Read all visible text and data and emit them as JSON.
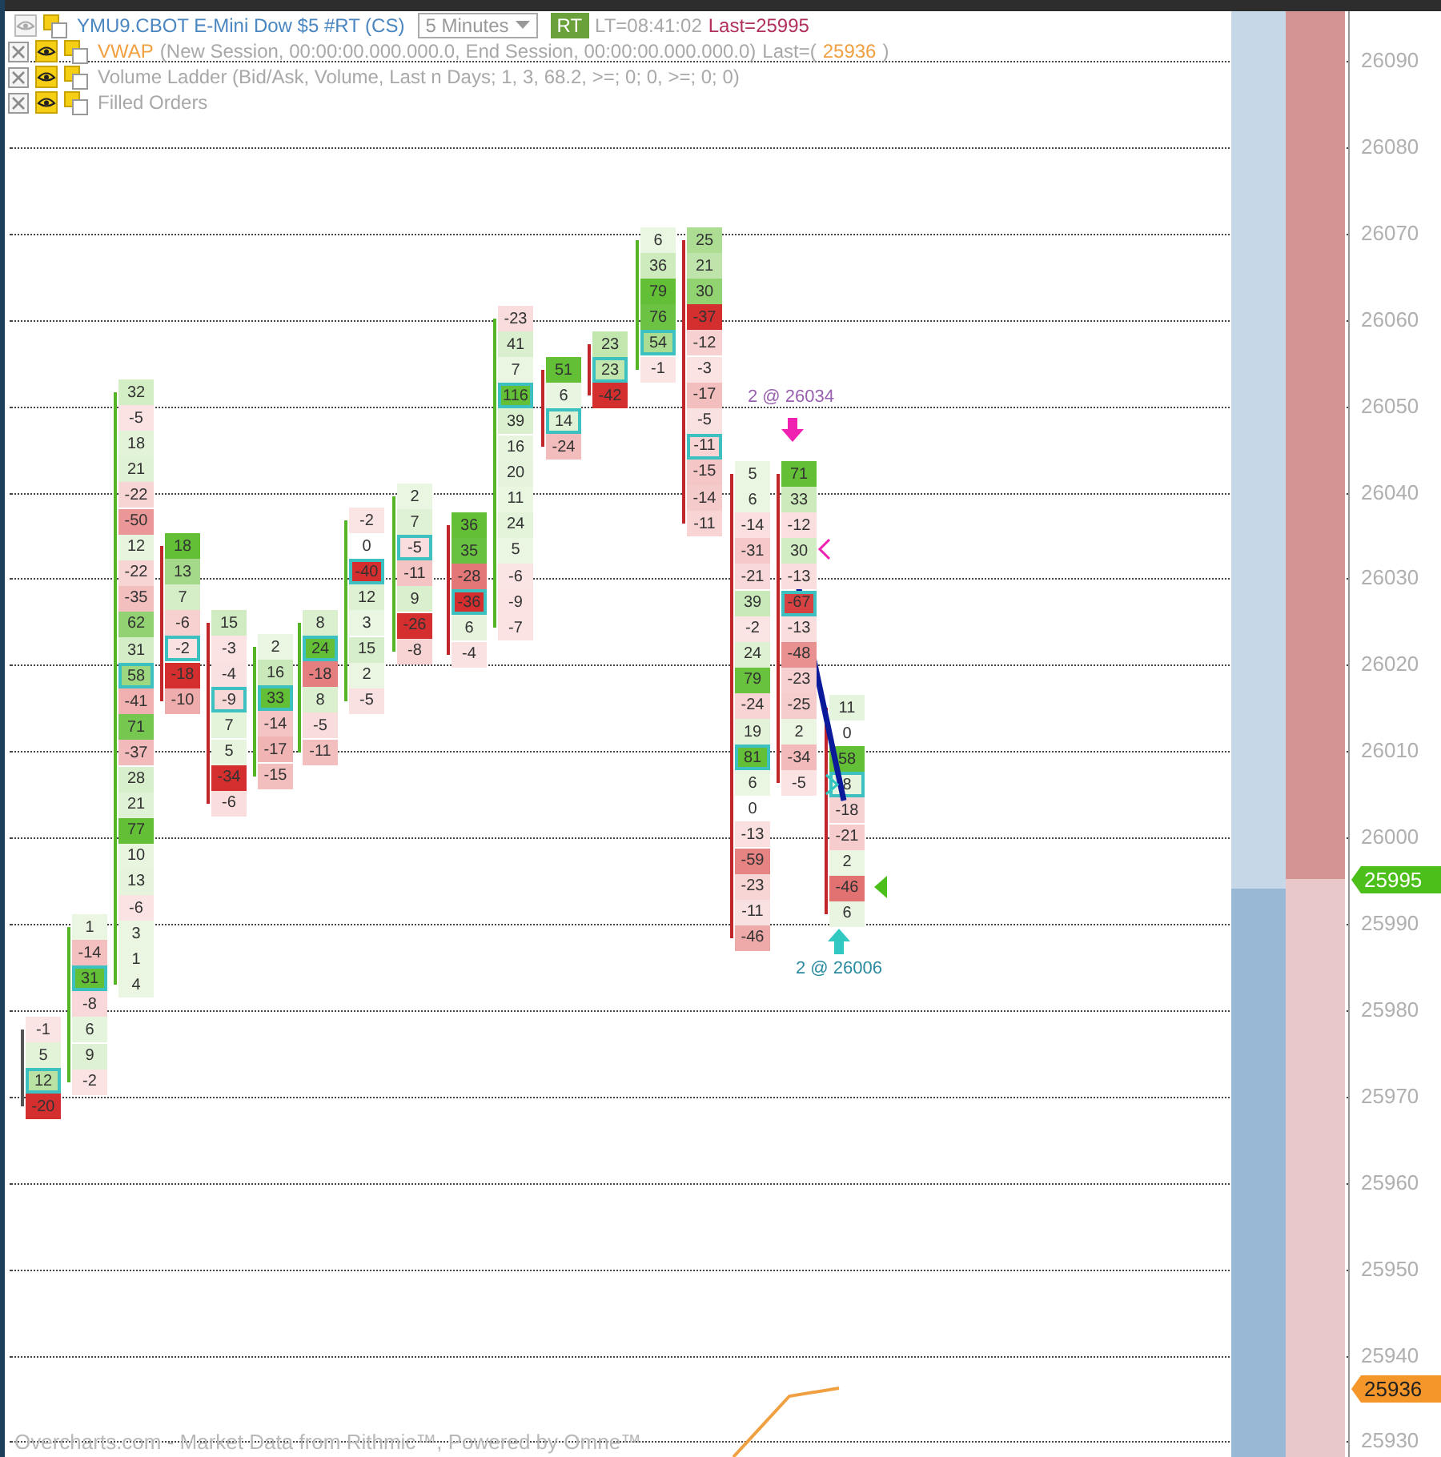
{
  "legend": [
    {
      "kind": "main",
      "visible": false,
      "parts": [
        {
          "kind": "symbol",
          "text": "YMU9.CBOT E-Mini Dow $5 #RT (CS)"
        },
        {
          "kind": "dropdown",
          "text": "5 Minutes"
        },
        {
          "kind": "badge",
          "text": "RT"
        },
        {
          "kind": "info",
          "text": "LT=08:41:02"
        },
        {
          "kind": "last",
          "text": "Last=25995"
        }
      ]
    },
    {
      "kind": "indicator",
      "visible": true,
      "parts": [
        {
          "kind": "name",
          "text": "VWAP"
        },
        {
          "kind": "info",
          "text": "(New Session, 00:00:00.000.000.0, End Session, 00:00:00.000.000.0)"
        },
        {
          "kind": "info",
          "text": "Last=("
        },
        {
          "kind": "value",
          "text": "25936"
        },
        {
          "kind": "info",
          "text": ")"
        }
      ]
    },
    {
      "kind": "indicator",
      "visible": true,
      "parts": [
        {
          "kind": "info",
          "text": "Volume Ladder (Bid/Ask, Volume, Last n Days; 1, 3, 68.2, >=; 0; 0, >=; 0; 0)"
        }
      ]
    },
    {
      "kind": "indicator",
      "visible": true,
      "parts": [
        {
          "kind": "info",
          "text": "Filled Orders"
        }
      ]
    }
  ],
  "footprint": {
    "bars": [
      {
        "kind": "flat",
        "cells": [
          {
            "value": "-1",
            "highlighted": false
          },
          {
            "value": "5",
            "highlighted": false
          },
          {
            "value": "12",
            "highlighted": true
          },
          {
            "value": "-20",
            "highlighted": false
          }
        ]
      },
      {
        "kind": "up",
        "cells": [
          {
            "value": "1",
            "highlighted": false
          },
          {
            "value": "-14",
            "highlighted": false
          },
          {
            "value": "31",
            "highlighted": true
          },
          {
            "value": "-8",
            "highlighted": false
          },
          {
            "value": "6",
            "highlighted": false
          },
          {
            "value": "9",
            "highlighted": false
          },
          {
            "value": "-2",
            "highlighted": false
          }
        ]
      },
      {
        "kind": "up",
        "cells": [
          {
            "value": "32",
            "highlighted": false
          },
          {
            "value": "-5",
            "highlighted": false
          },
          {
            "value": "18",
            "highlighted": false
          },
          {
            "value": "21",
            "highlighted": false
          },
          {
            "value": "-22",
            "highlighted": false
          },
          {
            "value": "-50",
            "highlighted": false
          },
          {
            "value": "12",
            "highlighted": false
          },
          {
            "value": "-22",
            "highlighted": false
          },
          {
            "value": "-35",
            "highlighted": false
          },
          {
            "value": "62",
            "highlighted": false
          },
          {
            "value": "31",
            "highlighted": false
          },
          {
            "value": "58",
            "highlighted": true
          },
          {
            "value": "-41",
            "highlighted": false
          },
          {
            "value": "71",
            "highlighted": false
          },
          {
            "value": "-37",
            "highlighted": false
          },
          {
            "value": "28",
            "highlighted": false
          },
          {
            "value": "21",
            "highlighted": false
          },
          {
            "value": "77",
            "highlighted": false
          },
          {
            "value": "10",
            "highlighted": false
          },
          {
            "value": "13",
            "highlighted": false
          },
          {
            "value": "-6",
            "highlighted": false
          },
          {
            "value": "3",
            "highlighted": false
          },
          {
            "value": "1",
            "highlighted": false
          },
          {
            "value": "4",
            "highlighted": false
          }
        ]
      },
      {
        "kind": "down",
        "cells": [
          {
            "value": "18",
            "highlighted": false
          },
          {
            "value": "13",
            "highlighted": false
          },
          {
            "value": "7",
            "highlighted": false
          },
          {
            "value": "-6",
            "highlighted": false
          },
          {
            "value": "-2",
            "highlighted": true
          },
          {
            "value": "-18",
            "highlighted": false
          },
          {
            "value": "-10",
            "highlighted": false
          }
        ]
      },
      {
        "kind": "down",
        "cells": [
          {
            "value": "15",
            "highlighted": false
          },
          {
            "value": "-3",
            "highlighted": false
          },
          {
            "value": "-4",
            "highlighted": false
          },
          {
            "value": "-9",
            "highlighted": true
          },
          {
            "value": "7",
            "highlighted": false
          },
          {
            "value": "5",
            "highlighted": false
          },
          {
            "value": "-34",
            "highlighted": false
          },
          {
            "value": "-6",
            "highlighted": false
          }
        ]
      },
      {
        "kind": "up",
        "cells": [
          {
            "value": "2",
            "highlighted": false
          },
          {
            "value": "16",
            "highlighted": false
          },
          {
            "value": "33",
            "highlighted": true
          },
          {
            "value": "-14",
            "highlighted": false
          },
          {
            "value": "-17",
            "highlighted": false
          },
          {
            "value": "-15",
            "highlighted": false
          }
        ]
      },
      {
        "kind": "up",
        "cells": [
          {
            "value": "8",
            "highlighted": false
          },
          {
            "value": "24",
            "highlighted": true
          },
          {
            "value": "-18",
            "highlighted": false
          },
          {
            "value": "8",
            "highlighted": false
          },
          {
            "value": "-5",
            "highlighted": false
          },
          {
            "value": "-11",
            "highlighted": false
          }
        ]
      },
      {
        "kind": "up",
        "cells": [
          {
            "value": "-2",
            "highlighted": false
          },
          {
            "value": "0",
            "highlighted": false
          },
          {
            "value": "-40",
            "highlighted": true
          },
          {
            "value": "12",
            "highlighted": false
          },
          {
            "value": "3",
            "highlighted": false
          },
          {
            "value": "15",
            "highlighted": false
          },
          {
            "value": "2",
            "highlighted": false
          },
          {
            "value": "-5",
            "highlighted": false
          }
        ]
      },
      {
        "kind": "up",
        "cells": [
          {
            "value": "2",
            "highlighted": false
          },
          {
            "value": "7",
            "highlighted": false
          },
          {
            "value": "-5",
            "highlighted": true
          },
          {
            "value": "-11",
            "highlighted": false
          },
          {
            "value": "9",
            "highlighted": false
          },
          {
            "value": "-26",
            "highlighted": false
          },
          {
            "value": "-8",
            "highlighted": false
          }
        ]
      },
      {
        "kind": "down",
        "cells": [
          {
            "value": "36",
            "highlighted": false
          },
          {
            "value": "35",
            "highlighted": false
          },
          {
            "value": "-28",
            "highlighted": false
          },
          {
            "value": "-36",
            "highlighted": true
          },
          {
            "value": "6",
            "highlighted": false
          },
          {
            "value": "-4",
            "highlighted": false
          }
        ]
      },
      {
        "kind": "up",
        "cells": [
          {
            "value": "-23",
            "highlighted": false
          },
          {
            "value": "41",
            "highlighted": false
          },
          {
            "value": "7",
            "highlighted": false
          },
          {
            "value": "116",
            "highlighted": true
          },
          {
            "value": "39",
            "highlighted": false
          },
          {
            "value": "16",
            "highlighted": false
          },
          {
            "value": "20",
            "highlighted": false
          },
          {
            "value": "11",
            "highlighted": false
          },
          {
            "value": "24",
            "highlighted": false
          },
          {
            "value": "5",
            "highlighted": false
          },
          {
            "value": "-6",
            "highlighted": false
          },
          {
            "value": "-9",
            "highlighted": false
          },
          {
            "value": "-7",
            "highlighted": false
          }
        ]
      },
      {
        "kind": "down",
        "cells": [
          {
            "value": "51",
            "highlighted": false
          },
          {
            "value": "6",
            "highlighted": false
          },
          {
            "value": "14",
            "highlighted": true
          },
          {
            "value": "-24",
            "highlighted": false
          }
        ]
      },
      {
        "kind": "down",
        "cells": [
          {
            "value": "23",
            "highlighted": false
          },
          {
            "value": "23",
            "highlighted": true
          },
          {
            "value": "-42",
            "highlighted": false
          }
        ]
      },
      {
        "kind": "up",
        "cells": [
          {
            "value": "6",
            "highlighted": false
          },
          {
            "value": "36",
            "highlighted": false
          },
          {
            "value": "79",
            "highlighted": false
          },
          {
            "value": "76",
            "highlighted": false
          },
          {
            "value": "54",
            "highlighted": true
          },
          {
            "value": "-1",
            "highlighted": false
          }
        ]
      },
      {
        "kind": "down",
        "cells": [
          {
            "value": "25",
            "highlighted": false
          },
          {
            "value": "21",
            "highlighted": false
          },
          {
            "value": "30",
            "highlighted": false
          },
          {
            "value": "-37",
            "highlighted": false
          },
          {
            "value": "-12",
            "highlighted": false
          },
          {
            "value": "-3",
            "highlighted": false
          },
          {
            "value": "-17",
            "highlighted": false
          },
          {
            "value": "-5",
            "highlighted": false
          },
          {
            "value": "-11",
            "highlighted": true
          },
          {
            "value": "-15",
            "highlighted": false
          },
          {
            "value": "-14",
            "highlighted": false
          },
          {
            "value": "-11",
            "highlighted": false
          }
        ]
      },
      {
        "kind": "down",
        "cells": [
          {
            "value": "5",
            "highlighted": false
          },
          {
            "value": "6",
            "highlighted": false
          },
          {
            "value": "-14",
            "highlighted": false
          },
          {
            "value": "-31",
            "highlighted": false
          },
          {
            "value": "-21",
            "highlighted": false
          },
          {
            "value": "39",
            "highlighted": false
          },
          {
            "value": "-2",
            "highlighted": false
          },
          {
            "value": "24",
            "highlighted": false
          },
          {
            "value": "79",
            "highlighted": false
          },
          {
            "value": "-24",
            "highlighted": false
          },
          {
            "value": "19",
            "highlighted": false
          },
          {
            "value": "81",
            "highlighted": true
          },
          {
            "value": "6",
            "highlighted": false
          },
          {
            "value": "0",
            "highlighted": false
          },
          {
            "value": "-13",
            "highlighted": false
          },
          {
            "value": "-59",
            "highlighted": false
          },
          {
            "value": "-23",
            "highlighted": false
          },
          {
            "value": "-11",
            "highlighted": false
          },
          {
            "value": "-46",
            "highlighted": false
          }
        ]
      },
      {
        "kind": "down",
        "cells": [
          {
            "value": "71",
            "highlighted": false
          },
          {
            "value": "33",
            "highlighted": false
          },
          {
            "value": "-12",
            "highlighted": false
          },
          {
            "value": "30",
            "highlighted": false
          },
          {
            "value": "-13",
            "highlighted": false
          },
          {
            "value": "-67",
            "highlighted": true
          },
          {
            "value": "-13",
            "highlighted": false
          },
          {
            "value": "-48",
            "highlighted": false
          },
          {
            "value": "-23",
            "highlighted": false
          },
          {
            "value": "-25",
            "highlighted": false
          },
          {
            "value": "2",
            "highlighted": false
          },
          {
            "value": "-34",
            "highlighted": false
          },
          {
            "value": "-5",
            "highlighted": false
          }
        ]
      },
      {
        "kind": "down",
        "cells": [
          {
            "value": "11",
            "highlighted": false
          },
          {
            "value": "0",
            "highlighted": false
          },
          {
            "value": "58",
            "highlighted": false
          },
          {
            "value": "8",
            "highlighted": true
          },
          {
            "value": "-18",
            "highlighted": false
          },
          {
            "value": "-21",
            "highlighted": false
          },
          {
            "value": "2",
            "highlighted": false
          },
          {
            "value": "-46",
            "highlighted": false
          },
          {
            "value": "6",
            "highlighted": false
          }
        ]
      }
    ]
  },
  "orders": [
    {
      "kind": "sell",
      "text": "2 @ 26034"
    },
    {
      "kind": "buy",
      "text": "2 @ 26006"
    }
  ],
  "price_axis": {
    "labels": [
      "26090",
      "26080",
      "26070",
      "26060",
      "26050",
      "26040",
      "26030",
      "26020",
      "26010",
      "26000",
      "25990",
      "25980",
      "25970",
      "25960",
      "25950",
      "25940",
      "25930"
    ]
  },
  "price_tags": [
    {
      "kind": "last",
      "text": "25995"
    },
    {
      "kind": "vwap",
      "text": "25936"
    }
  ],
  "footer": "Overcharts.com - Market Data from Rithmic™, Powered by Omne™"
}
